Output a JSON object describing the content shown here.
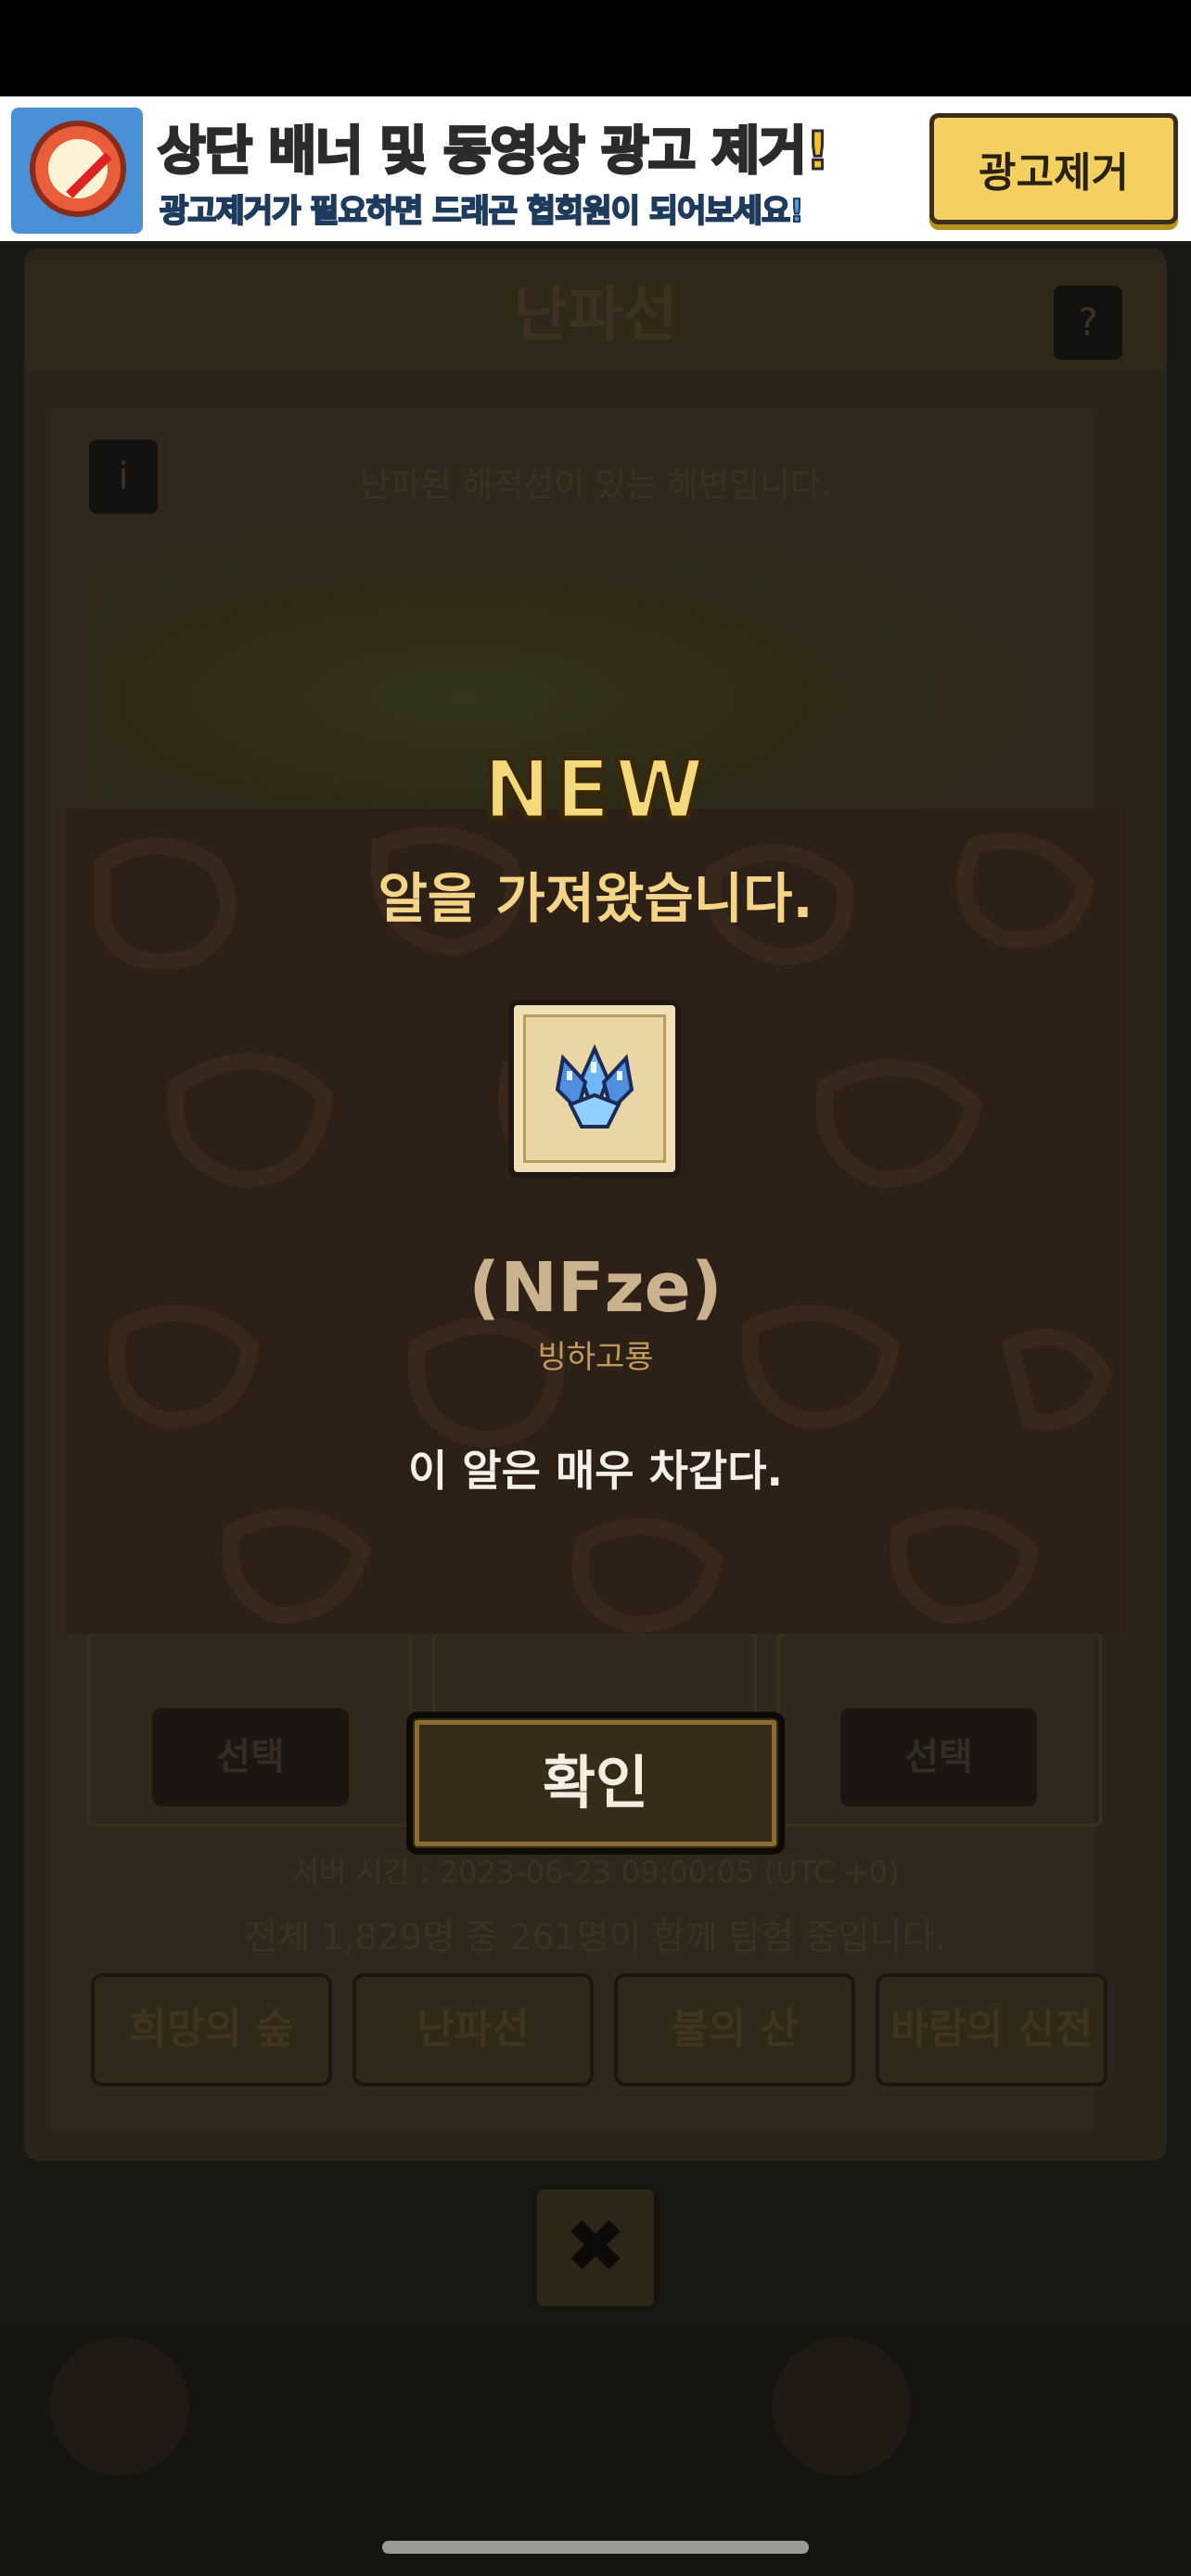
{
  "ad_banner": {
    "title": "상단 배너 및 동영상 광고 제거!",
    "subtitle": "광고제거가 필요하면 드래곤 협회원이 되어보세요!",
    "button_label": "광고제거",
    "icon": "no-ads-clock-icon"
  },
  "background": {
    "title": "난파선",
    "help_icon": "?",
    "info_icon": "i",
    "description": "난파된 해적선이 있는 해변입니다.",
    "slots": [
      {
        "select_label": "선택"
      },
      {
        "select_label": "선택"
      }
    ],
    "server_time": "서버 시간 : 2023-06-23 09:00:05 (UTC +0)",
    "player_count": "전체 1,829명 중 261명이 함께 탐험 중입니다.",
    "tabs": [
      {
        "label": "희망의 숲"
      },
      {
        "label": "난파선"
      },
      {
        "label": "불의 산"
      },
      {
        "label": "바람의 신전"
      }
    ],
    "close_icon": "✖"
  },
  "popup": {
    "new_label": "NEW",
    "title": "알을 가져왔습니다.",
    "egg_icon": "ice-crystal-egg-icon",
    "egg_name": "(NFze)",
    "egg_type": "빙하고룡",
    "egg_description": "이 알은 매우 차갑다.",
    "confirm_label": "확인"
  },
  "colors": {
    "accent_gold": "#f4d486",
    "popup_bg": "#2d2117",
    "ad_yellow": "#f2c22c"
  }
}
